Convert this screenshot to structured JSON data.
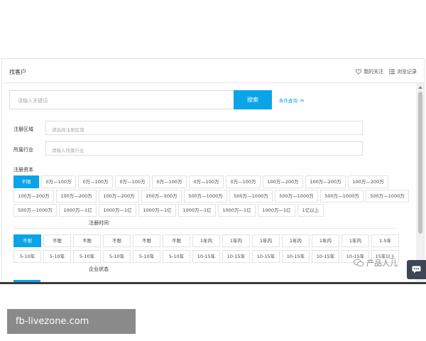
{
  "header": {
    "title": "找客户",
    "follow_label": "我的关注",
    "history_label": "浏览记录"
  },
  "search": {
    "placeholder": "请输入关键词",
    "button_label": "搜索",
    "advanced_label": "条件查询"
  },
  "filters": {
    "region": {
      "label": "注册区域",
      "placeholder": "请选择注册区域"
    },
    "industry": {
      "label": "所属行业",
      "placeholder": "请输入所属行业"
    }
  },
  "capital": {
    "label": "注册资本",
    "rows": [
      [
        "不限",
        "0万—100万",
        "0万—100万",
        "0万—100万",
        "0万—100万",
        "0万—100万",
        "0万—100万",
        "100万—200万",
        "100万—200万",
        "100万—200万"
      ],
      [
        "100万—200万",
        "100万—200万",
        "100万—200万",
        "200万—500万",
        "500万—1000万",
        "500万—1000万",
        "500万—1000万",
        "500万—1000万",
        "500万—1000万"
      ],
      [
        "500万—1000万",
        "1000万—1亿",
        "1000万—1亿",
        "1000万—1亿",
        "1000万—1亿",
        "1000万—1亿",
        "1000万—1亿",
        "1亿以上"
      ]
    ]
  },
  "reg_time": {
    "label": "注册时间",
    "rows": [
      [
        "不限",
        "不限",
        "不限",
        "不限",
        "不限",
        "不限",
        "1年内",
        "1年内",
        "1年内",
        "1年内",
        "1年内",
        "1年内",
        "1-5年"
      ],
      [
        "5-10年",
        "5-10年",
        "5-10年",
        "5-10年",
        "5-10年",
        "5-10年",
        "10-15年",
        "10-15年",
        "10-15年",
        "10-15年",
        "10-15年",
        "10-15年",
        "15年以上"
      ]
    ]
  },
  "status": {
    "label": "企业状态"
  },
  "watermark": {
    "text": "产品人儿"
  },
  "footer": {
    "label": "fb-livezone.com"
  },
  "colors": {
    "accent": "#0aa5e8",
    "chat_widget": "#3d4656"
  }
}
